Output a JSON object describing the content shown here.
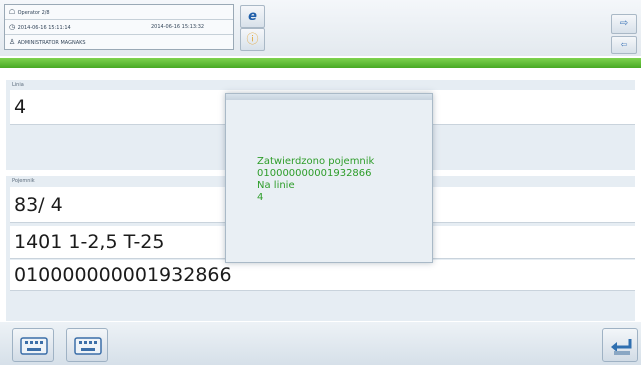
{
  "header": {
    "info_rows": [
      {
        "icon": "user-icon",
        "text": "Operator 2/8",
        "right": ""
      },
      {
        "icon": "clock-icon",
        "text": "2014-06-16 15:11:14",
        "right": "2014-06-16 15:13:32"
      },
      {
        "icon": "person-icon",
        "text": "ADMINISTRATOR MAGNAKS",
        "right": ""
      }
    ],
    "buttons": {
      "help_glyph": "e",
      "info_glyph": "ⓘ",
      "right_top_glyph": "⇨",
      "right_bottom_glyph": "⇦"
    }
  },
  "fields": {
    "label_top": "Linia",
    "label_bottom": "Pojemnik",
    "line_value": "4",
    "position_value": "83/  4",
    "product_value": "1401 1-2,5 T-25",
    "barcode_value": "010000000001932866"
  },
  "modal": {
    "line1": "Zatwierdzono pojemnik",
    "line2": "010000000001932866",
    "line3": "Na linie",
    "line4": "4"
  },
  "footer": {
    "keyboard1": "keyboard-icon",
    "keyboard2": "keyboard-icon",
    "enter": "enter-icon"
  },
  "colors": {
    "accent_green": "#48a924",
    "message_green": "#2e9d2a",
    "panel_bg": "#e6edf3"
  }
}
